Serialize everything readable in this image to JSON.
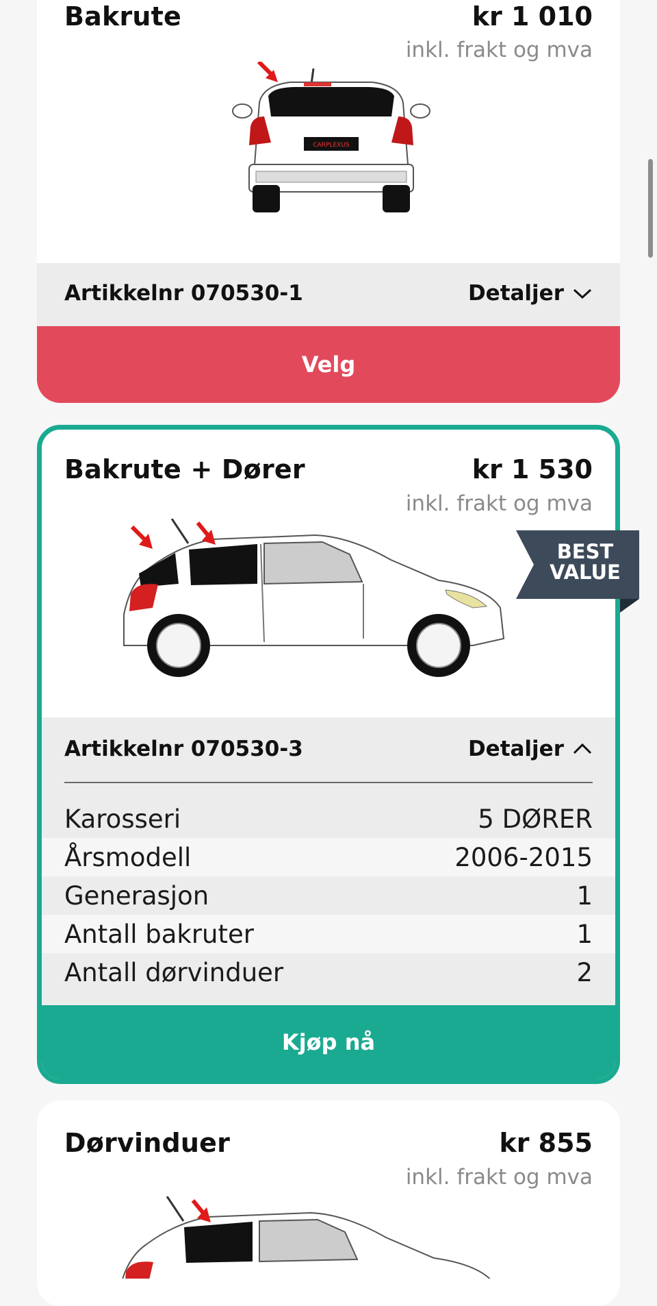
{
  "cards": [
    {
      "title": "Bakrute",
      "price": "kr 1 010",
      "price_note": "inkl. frakt og mva",
      "article": "Artikkelnr 070530-1",
      "details_label": "Detaljer",
      "button_label": "Velg",
      "button_color": "#e24a5c"
    },
    {
      "title": "Bakrute + Dører",
      "price": "kr 1 530",
      "price_note": "inkl. frakt og mva",
      "article": "Artikkelnr 070530-3",
      "details_label": "Detaljer",
      "button_label": "Kjøp nå",
      "button_color": "#1aaa91",
      "badge": {
        "line1": "BEST",
        "line2": "VALUE"
      },
      "specs": [
        {
          "label": "Karosseri",
          "value": "5 DØRER"
        },
        {
          "label": "Årsmodell",
          "value": "2006-2015"
        },
        {
          "label": "Generasjon",
          "value": "1"
        },
        {
          "label": "Antall bakruter",
          "value": "1"
        },
        {
          "label": "Antall dørvinduer",
          "value": "2"
        }
      ]
    },
    {
      "title": "Dørvinduer",
      "price": "kr 855",
      "price_note": "inkl. frakt og mva"
    }
  ],
  "icons": {
    "chevron_down": "chevron-down-icon",
    "chevron_up": "chevron-up-icon",
    "arrow": "red-arrow-icon"
  },
  "colors": {
    "accent_green": "#1aaa91",
    "accent_red": "#e24a5c",
    "badge_bg": "#3d4a5a"
  }
}
